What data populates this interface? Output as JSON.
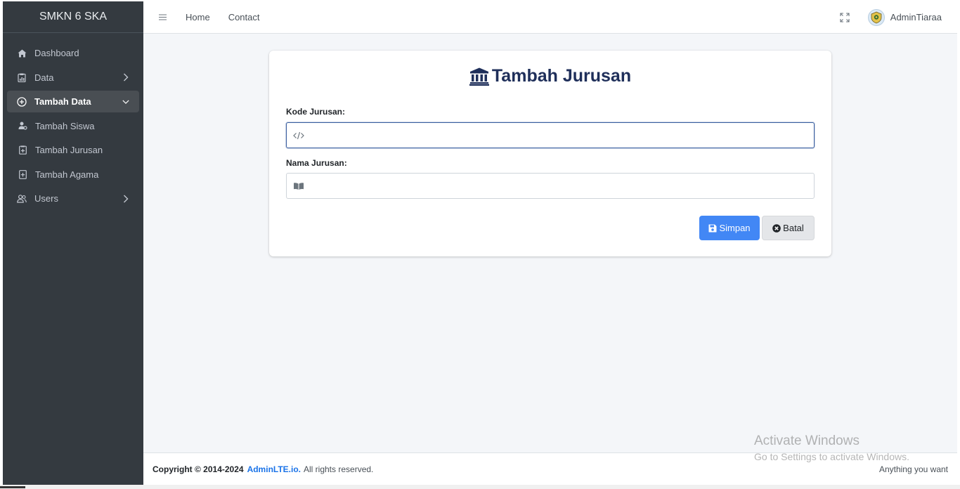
{
  "brand": "SMKN 6 SKA",
  "sidebar": {
    "items": [
      {
        "label": "Dashboard",
        "icon": "home-icon"
      },
      {
        "label": "Data",
        "icon": "clipboard-icon"
      },
      {
        "label": "Tambah Data",
        "icon": "plus-circle-icon"
      },
      {
        "label": "Tambah Siswa",
        "icon": "user-gear-icon"
      },
      {
        "label": "Tambah Jurusan",
        "icon": "file-plus-icon"
      },
      {
        "label": "Tambah Agama",
        "icon": "file-plus-icon"
      },
      {
        "label": "Users",
        "icon": "users-icon"
      }
    ]
  },
  "navbar": {
    "links": [
      "Home",
      "Contact"
    ],
    "user_name": "AdminTiaraa"
  },
  "form": {
    "title": "Tambah Jurusan",
    "kode_label": "Kode Jurusan:",
    "kode_value": "",
    "nama_label": "Nama Jurusan:",
    "nama_value": "",
    "save_label": "Simpan",
    "cancel_label": "Batal"
  },
  "footer": {
    "copyright": "Copyright © 2014-2024",
    "brand_link": "AdminLTE.io.",
    "rights": "All rights reserved.",
    "right_text": "Anything you want"
  },
  "watermark": {
    "line1": "Activate Windows",
    "line2": "Go to Settings to activate Windows."
  },
  "colors": {
    "sidebar_bg": "#343a40",
    "primary": "#4287f5",
    "title": "#1f2f5a"
  }
}
